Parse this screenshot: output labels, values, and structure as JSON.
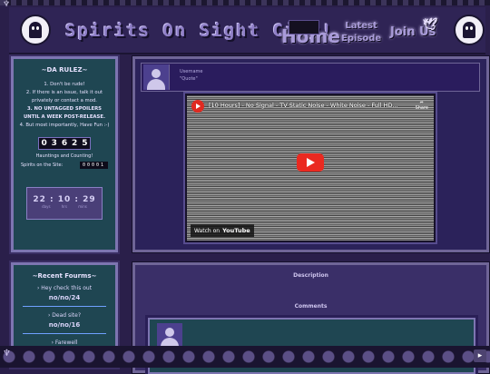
{
  "header": {
    "site_title": "Spirits On Sight City!",
    "nav": {
      "home": "Home",
      "latest_line1": "Latest",
      "latest_line2": "Episode",
      "join": "Join Us"
    }
  },
  "rules_box": {
    "title": "~DA RULEZ~",
    "rules": [
      "1. Don't be rude!",
      "2. If there is an issue, talk it out privately or contact a mod.",
      "3. NO UNTAGGED SPOILERS UNTIL A WEEK POST-RELEASE.",
      "4. But most importantly, Have Fun :-)"
    ],
    "counter_digits": [
      "0",
      "3",
      "6",
      "2",
      "5"
    ],
    "counter_caption": "Hauntings and Counting!",
    "spirits_label": "Spirits on the Site:",
    "spirits_value": "00001",
    "clock": {
      "time": "22 : 10 : 29",
      "labels": [
        "days",
        "hrs",
        "mins"
      ]
    }
  },
  "recent_forums": {
    "title": "~Recent Fourms~",
    "items": [
      {
        "title": "› Hey check this out",
        "date": "no/no/24"
      },
      {
        "title": "› Dead site?",
        "date": "no/no/16"
      },
      {
        "title": "› Farewell",
        "date": ""
      }
    ]
  },
  "post": {
    "username": "Username",
    "quote": "\"Quote\"",
    "video": {
      "title": "[10 Hours] - No Signal - TV Static Noise - White Noise - Full HD...",
      "share_label": "Share",
      "watch_on": "Watch on",
      "platform": "YouTube"
    }
  },
  "lower": {
    "description_label": "Description",
    "comments_label": "Comments"
  },
  "colors": {
    "page_bg": "#2a1f4a",
    "sidebox_bg": "#1f4652",
    "border": "#7d75b1",
    "play_red": "#ea2920"
  },
  "icons": {
    "logo": "ghost-icon",
    "footer_left": "ghost-glyph-icon",
    "footer_right": "scroll-button-icon"
  }
}
